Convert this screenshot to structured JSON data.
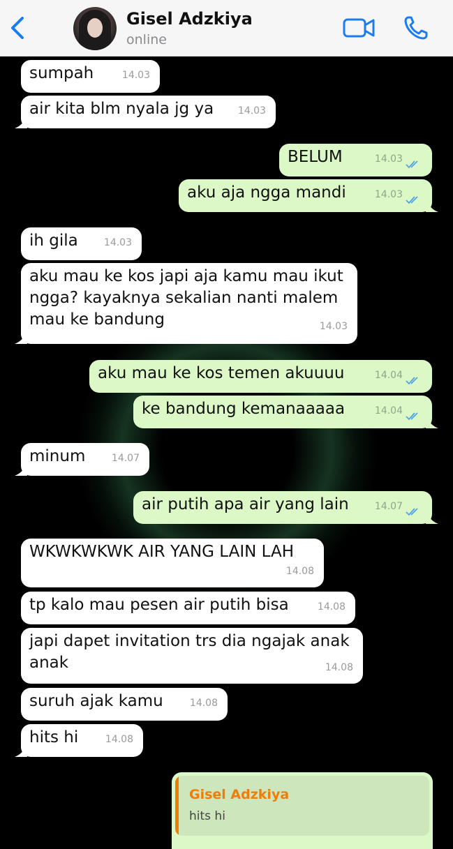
{
  "header": {
    "contact_name": "Gisel Adzkiya",
    "status": "online",
    "accent_color": "#1a7cf0"
  },
  "messages": [
    {
      "direction": "in",
      "text": "sumpah",
      "time": "14.03"
    },
    {
      "direction": "in",
      "text": "air kita blm nyala jg ya",
      "time": "14.03"
    },
    {
      "direction": "out",
      "text": "BELUM",
      "time": "14.03",
      "read": true
    },
    {
      "direction": "out",
      "text": "aku aja ngga mandi",
      "time": "14.03",
      "read": true
    },
    {
      "direction": "in",
      "text": "ih gila",
      "time": "14.03"
    },
    {
      "direction": "in",
      "text": "aku mau ke kos japi aja kamu mau ikut ngga? kayaknya sekalian nanti malem mau ke bandung",
      "time": "14.03"
    },
    {
      "direction": "out",
      "text": "aku mau ke kos temen akuuuu",
      "time": "14.04",
      "read": true
    },
    {
      "direction": "out",
      "text": "ke bandung kemanaaaaa",
      "time": "14.04",
      "read": true
    },
    {
      "direction": "in",
      "text": "minum",
      "time": "14.07"
    },
    {
      "direction": "out",
      "text": "air putih apa air yang lain",
      "time": "14.07",
      "read": true
    },
    {
      "direction": "in",
      "text": "WKWKWKWK AIR YANG LAIN LAH",
      "time": "14.08"
    },
    {
      "direction": "in",
      "text": "tp kalo mau pesen air putih bisa",
      "time": "14.08"
    },
    {
      "direction": "in",
      "text": "japi dapet invitation trs dia ngajak anak anak",
      "time": "14.08"
    },
    {
      "direction": "in",
      "text": "suruh ajak kamu",
      "time": "14.08"
    },
    {
      "direction": "in",
      "text": "hits hi",
      "time": "14.08"
    }
  ],
  "reply_quote": {
    "name": "Gisel Adzkiya",
    "text": "hits hi",
    "name_color": "#f07c0a"
  },
  "colors": {
    "background": "#000000",
    "incoming_bubble": "#ffffff",
    "outgoing_bubble": "#dcf8c6",
    "read_ticks": "#4fa3e6"
  },
  "icons": [
    "chevron-left-icon",
    "video-camera-icon",
    "phone-icon",
    "double-check-icon"
  ]
}
